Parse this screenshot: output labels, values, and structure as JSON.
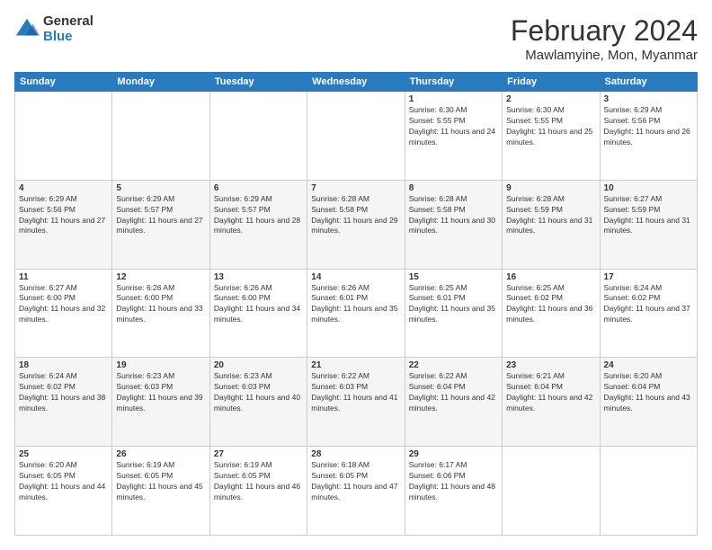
{
  "header": {
    "logo_general": "General",
    "logo_blue": "Blue",
    "month_title": "February 2024",
    "location": "Mawlamyine, Mon, Myanmar"
  },
  "weekdays": [
    "Sunday",
    "Monday",
    "Tuesday",
    "Wednesday",
    "Thursday",
    "Friday",
    "Saturday"
  ],
  "rows": [
    [
      {
        "day": "",
        "sunrise": "",
        "sunset": "",
        "daylight": ""
      },
      {
        "day": "",
        "sunrise": "",
        "sunset": "",
        "daylight": ""
      },
      {
        "day": "",
        "sunrise": "",
        "sunset": "",
        "daylight": ""
      },
      {
        "day": "",
        "sunrise": "",
        "sunset": "",
        "daylight": ""
      },
      {
        "day": "1",
        "sunrise": "6:30 AM",
        "sunset": "5:55 PM",
        "daylight": "11 hours and 24 minutes."
      },
      {
        "day": "2",
        "sunrise": "6:30 AM",
        "sunset": "5:55 PM",
        "daylight": "11 hours and 25 minutes."
      },
      {
        "day": "3",
        "sunrise": "6:29 AM",
        "sunset": "5:56 PM",
        "daylight": "11 hours and 26 minutes."
      }
    ],
    [
      {
        "day": "4",
        "sunrise": "6:29 AM",
        "sunset": "5:56 PM",
        "daylight": "11 hours and 27 minutes."
      },
      {
        "day": "5",
        "sunrise": "6:29 AM",
        "sunset": "5:57 PM",
        "daylight": "11 hours and 27 minutes."
      },
      {
        "day": "6",
        "sunrise": "6:29 AM",
        "sunset": "5:57 PM",
        "daylight": "11 hours and 28 minutes."
      },
      {
        "day": "7",
        "sunrise": "6:28 AM",
        "sunset": "5:58 PM",
        "daylight": "11 hours and 29 minutes."
      },
      {
        "day": "8",
        "sunrise": "6:28 AM",
        "sunset": "5:58 PM",
        "daylight": "11 hours and 30 minutes."
      },
      {
        "day": "9",
        "sunrise": "6:28 AM",
        "sunset": "5:59 PM",
        "daylight": "11 hours and 31 minutes."
      },
      {
        "day": "10",
        "sunrise": "6:27 AM",
        "sunset": "5:59 PM",
        "daylight": "11 hours and 31 minutes."
      }
    ],
    [
      {
        "day": "11",
        "sunrise": "6:27 AM",
        "sunset": "6:00 PM",
        "daylight": "11 hours and 32 minutes."
      },
      {
        "day": "12",
        "sunrise": "6:26 AM",
        "sunset": "6:00 PM",
        "daylight": "11 hours and 33 minutes."
      },
      {
        "day": "13",
        "sunrise": "6:26 AM",
        "sunset": "6:00 PM",
        "daylight": "11 hours and 34 minutes."
      },
      {
        "day": "14",
        "sunrise": "6:26 AM",
        "sunset": "6:01 PM",
        "daylight": "11 hours and 35 minutes."
      },
      {
        "day": "15",
        "sunrise": "6:25 AM",
        "sunset": "6:01 PM",
        "daylight": "11 hours and 35 minutes."
      },
      {
        "day": "16",
        "sunrise": "6:25 AM",
        "sunset": "6:02 PM",
        "daylight": "11 hours and 36 minutes."
      },
      {
        "day": "17",
        "sunrise": "6:24 AM",
        "sunset": "6:02 PM",
        "daylight": "11 hours and 37 minutes."
      }
    ],
    [
      {
        "day": "18",
        "sunrise": "6:24 AM",
        "sunset": "6:02 PM",
        "daylight": "11 hours and 38 minutes."
      },
      {
        "day": "19",
        "sunrise": "6:23 AM",
        "sunset": "6:03 PM",
        "daylight": "11 hours and 39 minutes."
      },
      {
        "day": "20",
        "sunrise": "6:23 AM",
        "sunset": "6:03 PM",
        "daylight": "11 hours and 40 minutes."
      },
      {
        "day": "21",
        "sunrise": "6:22 AM",
        "sunset": "6:03 PM",
        "daylight": "11 hours and 41 minutes."
      },
      {
        "day": "22",
        "sunrise": "6:22 AM",
        "sunset": "6:04 PM",
        "daylight": "11 hours and 42 minutes."
      },
      {
        "day": "23",
        "sunrise": "6:21 AM",
        "sunset": "6:04 PM",
        "daylight": "11 hours and 42 minutes."
      },
      {
        "day": "24",
        "sunrise": "6:20 AM",
        "sunset": "6:04 PM",
        "daylight": "11 hours and 43 minutes."
      }
    ],
    [
      {
        "day": "25",
        "sunrise": "6:20 AM",
        "sunset": "6:05 PM",
        "daylight": "11 hours and 44 minutes."
      },
      {
        "day": "26",
        "sunrise": "6:19 AM",
        "sunset": "6:05 PM",
        "daylight": "11 hours and 45 minutes."
      },
      {
        "day": "27",
        "sunrise": "6:19 AM",
        "sunset": "6:05 PM",
        "daylight": "11 hours and 46 minutes."
      },
      {
        "day": "28",
        "sunrise": "6:18 AM",
        "sunset": "6:05 PM",
        "daylight": "11 hours and 47 minutes."
      },
      {
        "day": "29",
        "sunrise": "6:17 AM",
        "sunset": "6:06 PM",
        "daylight": "11 hours and 48 minutes."
      },
      {
        "day": "",
        "sunrise": "",
        "sunset": "",
        "daylight": ""
      },
      {
        "day": "",
        "sunrise": "",
        "sunset": "",
        "daylight": ""
      }
    ]
  ]
}
